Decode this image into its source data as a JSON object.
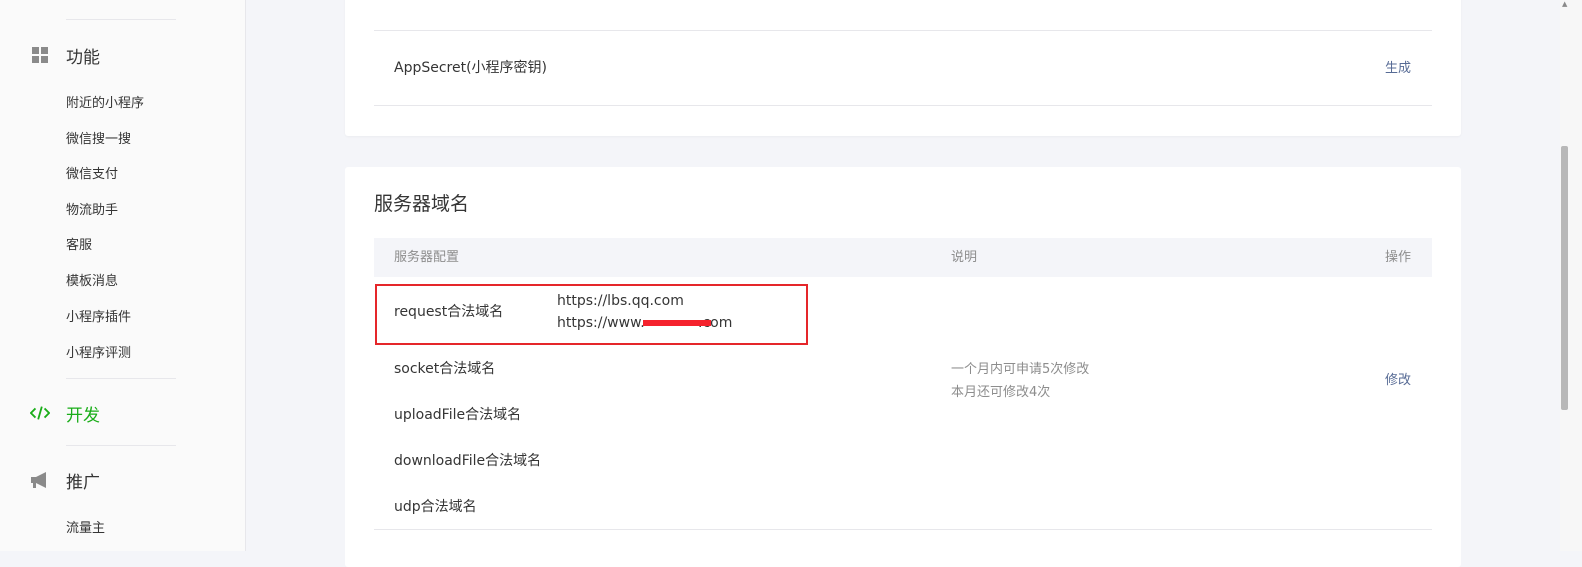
{
  "sidebar": {
    "sections": [
      {
        "label": "功能",
        "icon": "grid-icon",
        "active": false
      },
      {
        "label": "开发",
        "icon": "code-icon",
        "active": true
      },
      {
        "label": "推广",
        "icon": "megaphone-icon",
        "active": false
      }
    ],
    "function_items": [
      "附近的小程序",
      "微信搜一搜",
      "微信支付",
      "物流助手",
      "客服",
      "模板消息",
      "小程序插件",
      "小程序评测"
    ],
    "promo_items": [
      "流量主"
    ]
  },
  "app_secret": {
    "label": "AppSecret(小程序密钥)",
    "action": "生成"
  },
  "server_domain": {
    "title": "服务器域名",
    "columns": {
      "config": "服务器配置",
      "desc": "说明",
      "action": "操作"
    },
    "rows": [
      {
        "name": "request合法域名",
        "values": [
          "https://lbs.qq.com",
          "https://www.",
          ".com"
        ]
      },
      {
        "name": "socket合法域名"
      },
      {
        "name": "uploadFile合法域名"
      },
      {
        "name": "downloadFile合法域名"
      },
      {
        "name": "udp合法域名"
      }
    ],
    "desc_lines": [
      "一个月内可申请5次修改",
      "本月还可修改4次"
    ],
    "modify": "修改"
  },
  "colors": {
    "accent": "#1aad19",
    "link": "#576b95",
    "highlight": "#e5262a"
  }
}
